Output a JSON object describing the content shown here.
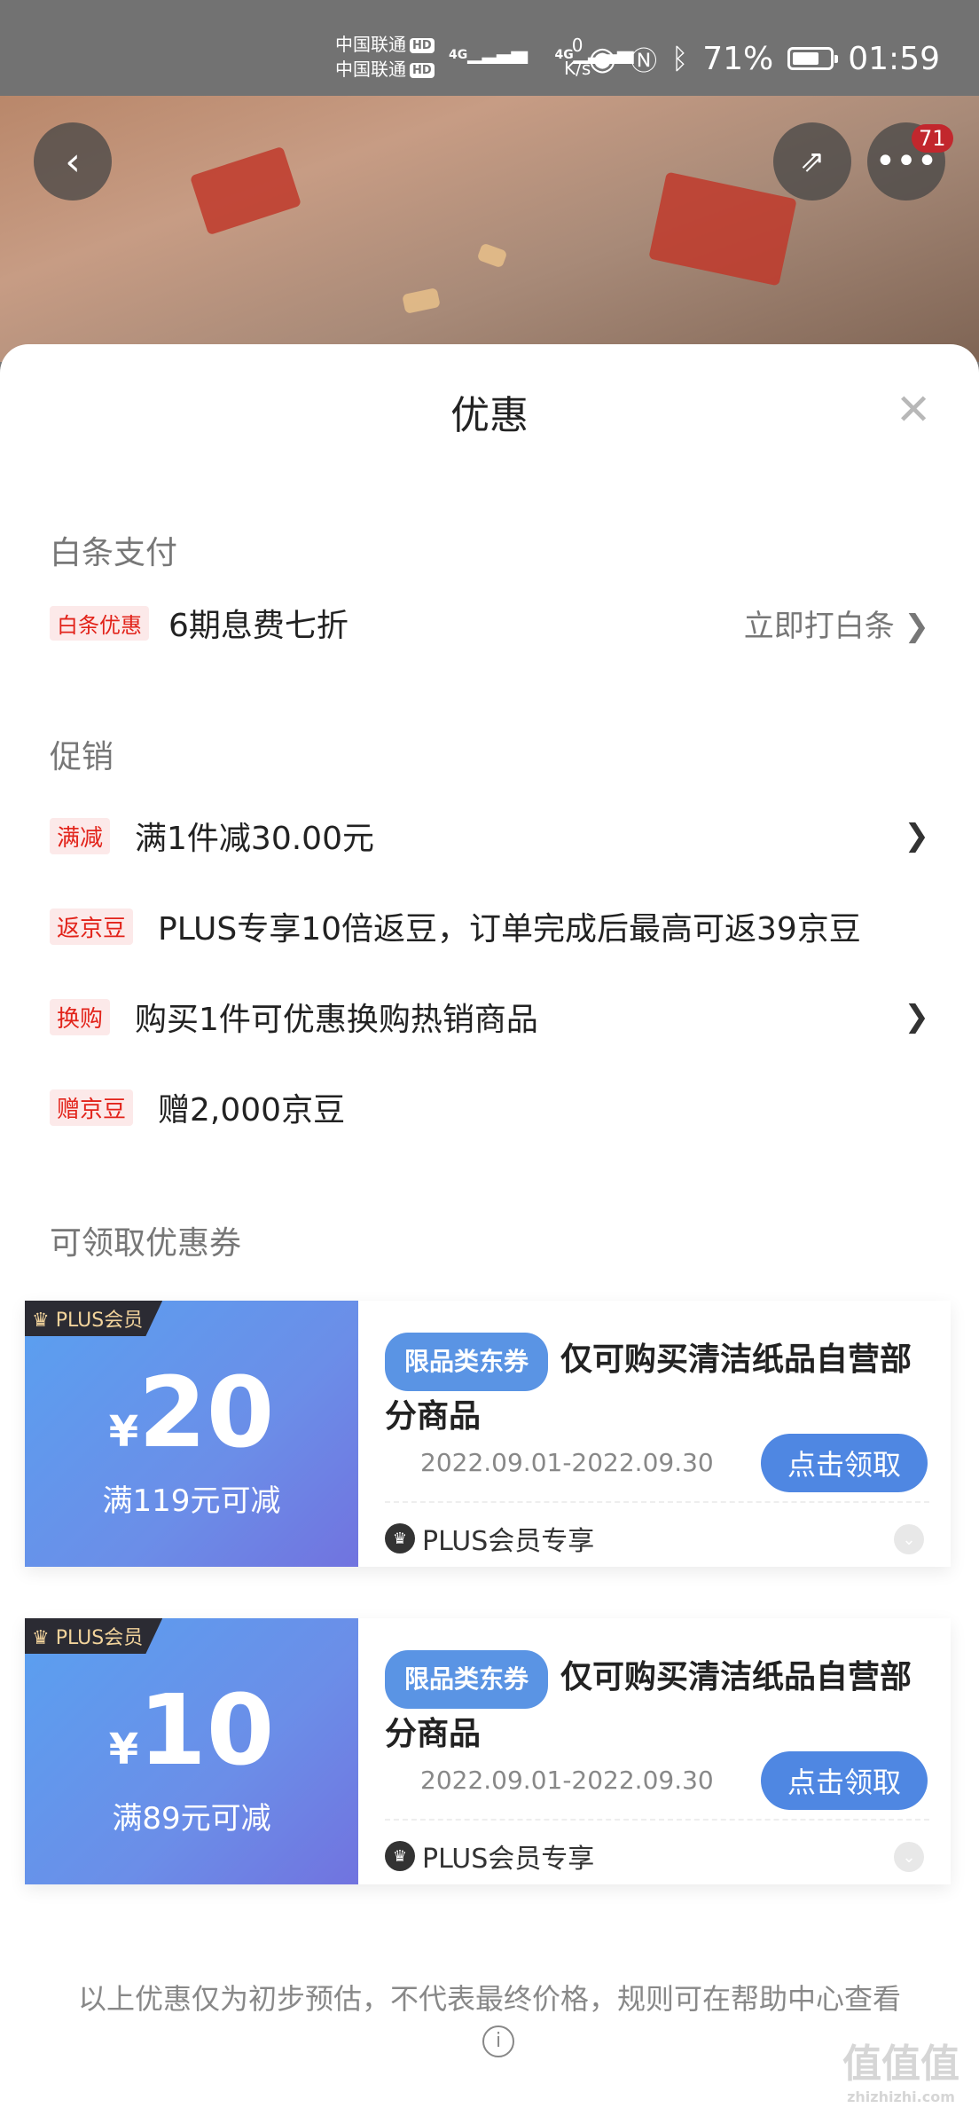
{
  "status": {
    "carrier1": "中国联通",
    "carrier2": "中国联通",
    "hd": "HD",
    "net1": "4G",
    "net2": "4G",
    "speed_value": "0",
    "speed_unit": "K/s",
    "battery": "71%",
    "battery_level": 0.71,
    "time": "01:59"
  },
  "header": {
    "badge": "71"
  },
  "sheet": {
    "title": "优惠"
  },
  "baitiao": {
    "section": "白条支付",
    "tag": "白条优惠",
    "text": "6期息费七折",
    "action": "立即打白条 ❯"
  },
  "promo": {
    "section": "促销",
    "items": [
      {
        "tag": "满减",
        "text": "满1件减30.00元",
        "chevron": "❯"
      },
      {
        "tag": "返京豆",
        "text": "PLUS专享10倍返豆，订单完成后最高可返39京豆"
      },
      {
        "tag": "换购",
        "text": "购买1件可优惠换购热销商品",
        "chevron": "❯"
      },
      {
        "tag": "赠京豆",
        "text": "赠2,000京豆"
      }
    ]
  },
  "coupons": {
    "section": "可领取优惠券",
    "items": [
      {
        "plus_tag": "PLUS会员",
        "yen": "¥",
        "amount": "20",
        "condition": "满119元可减",
        "limit_tag": "限品类东券",
        "desc": "仅可购买清洁纸品自营部分商品",
        "date": "2022.09.01-2022.09.30",
        "button": "点击领取",
        "plus_note": "PLUS会员专享"
      },
      {
        "plus_tag": "PLUS会员",
        "yen": "¥",
        "amount": "10",
        "condition": "满89元可减",
        "limit_tag": "限品类东券",
        "desc": "仅可购买清洁纸品自营部分商品",
        "date": "2022.09.01-2022.09.30",
        "button": "点击领取",
        "plus_note": "PLUS会员专享"
      }
    ]
  },
  "footer": {
    "text": "以上优惠仅为初步预估，不代表最终价格，规则可在帮助中心查看",
    "info_icon": "i"
  },
  "watermark": {
    "text": "值值值",
    "sub": "zhizhizhi.com"
  },
  "colors": {
    "accent": "#4f87e2",
    "tag_red": "#e2231a",
    "tag_bg": "#fce9e9"
  }
}
